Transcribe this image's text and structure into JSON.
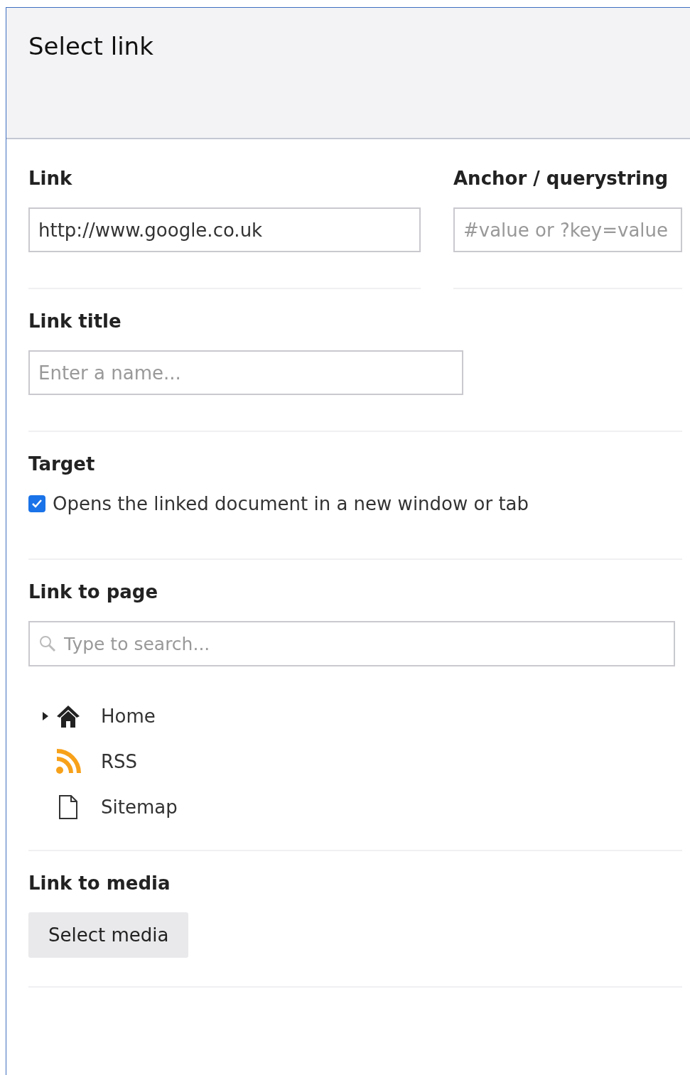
{
  "dialog": {
    "title": "Select link"
  },
  "link": {
    "label": "Link",
    "value": "http://www.google.co.uk"
  },
  "anchor": {
    "label": "Anchor / querystring",
    "placeholder": "#value or ?key=value"
  },
  "link_title": {
    "label": "Link title",
    "placeholder": "Enter a name..."
  },
  "target": {
    "label": "Target",
    "checkbox_label": "Opens the linked document in a new window or tab",
    "checked": true
  },
  "link_to_page": {
    "label": "Link to page",
    "search_placeholder": "Type to search...",
    "tree": [
      {
        "kind": "home",
        "label": "Home",
        "expandable": true
      },
      {
        "kind": "rss",
        "label": "RSS",
        "expandable": false
      },
      {
        "kind": "document",
        "label": "Sitemap",
        "expandable": false
      }
    ]
  },
  "link_to_media": {
    "label": "Link to media",
    "button": "Select media"
  }
}
